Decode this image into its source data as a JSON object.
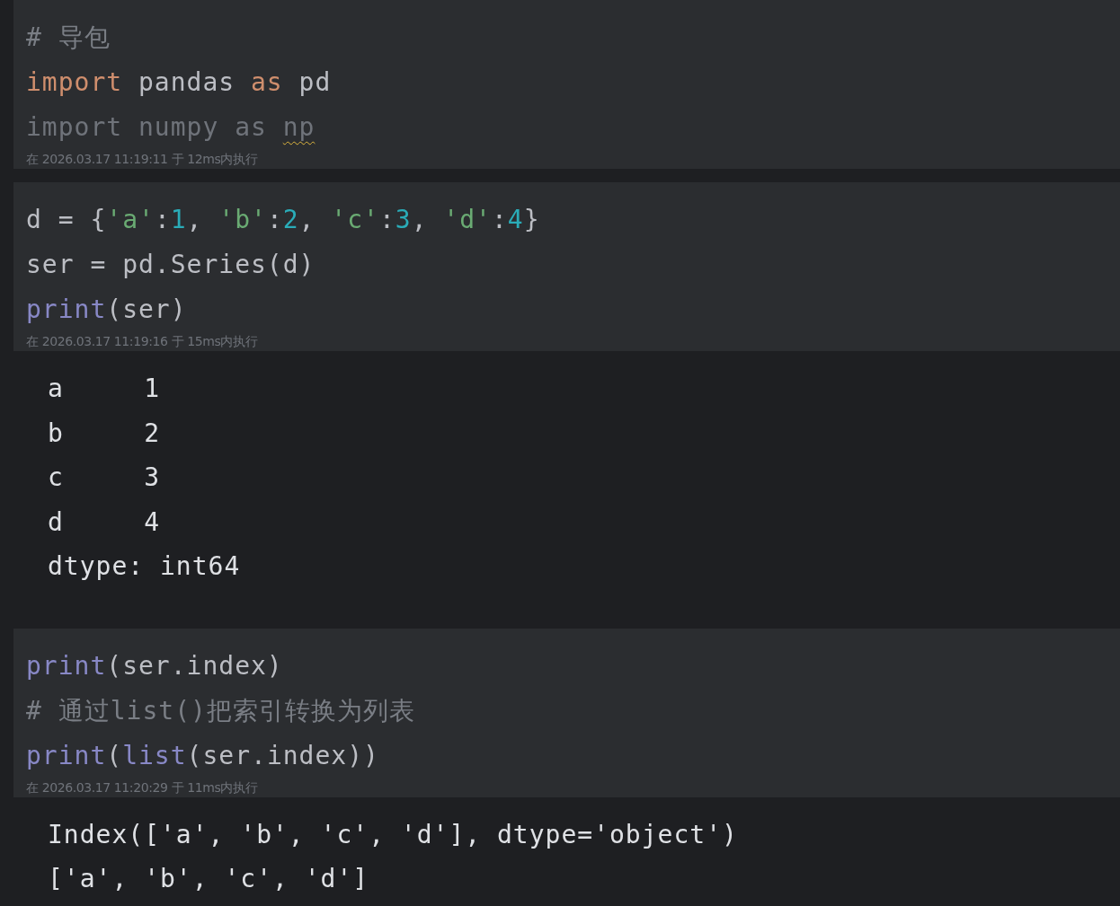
{
  "cells": [
    {
      "code": [
        [
          {
            "text": "# 导包",
            "kind": "comment"
          }
        ],
        [
          {
            "text": "import",
            "kind": "keyword"
          },
          {
            "text": " pandas ",
            "kind": "plain"
          },
          {
            "text": "as",
            "kind": "keyword"
          },
          {
            "text": " pd",
            "kind": "plain"
          }
        ],
        [
          {
            "text": "import numpy as ",
            "kind": "unused"
          },
          {
            "text": "np",
            "kind": "unused-warning"
          }
        ]
      ],
      "executed": "在 2026.03.17 11:19:11 于 12ms内执行"
    },
    {
      "code": [
        [
          {
            "text": "d = {",
            "kind": "plain"
          },
          {
            "text": "'a'",
            "kind": "string"
          },
          {
            "text": ":",
            "kind": "plain"
          },
          {
            "text": "1",
            "kind": "number"
          },
          {
            "text": ", ",
            "kind": "plain"
          },
          {
            "text": "'b'",
            "kind": "string"
          },
          {
            "text": ":",
            "kind": "plain"
          },
          {
            "text": "2",
            "kind": "number"
          },
          {
            "text": ", ",
            "kind": "plain"
          },
          {
            "text": "'c'",
            "kind": "string"
          },
          {
            "text": ":",
            "kind": "plain"
          },
          {
            "text": "3",
            "kind": "number"
          },
          {
            "text": ", ",
            "kind": "plain"
          },
          {
            "text": "'d'",
            "kind": "string"
          },
          {
            "text": ":",
            "kind": "plain"
          },
          {
            "text": "4",
            "kind": "number"
          },
          {
            "text": "}",
            "kind": "plain"
          }
        ],
        [
          {
            "text": "ser = pd.Series(d)",
            "kind": "plain"
          }
        ],
        [
          {
            "text": "print",
            "kind": "builtin"
          },
          {
            "text": "(ser)",
            "kind": "plain"
          }
        ]
      ],
      "executed": "在 2026.03.17 11:19:16 于 15ms内执行",
      "output": [
        "a     1",
        "b     2",
        "c     3",
        "d     4",
        "dtype: int64"
      ]
    },
    {
      "code": [
        [
          {
            "text": "print",
            "kind": "builtin"
          },
          {
            "text": "(ser.index)",
            "kind": "plain"
          }
        ],
        [
          {
            "text": "# 通过list()把索引转换为列表",
            "kind": "comment"
          }
        ],
        [
          {
            "text": "print",
            "kind": "builtin"
          },
          {
            "text": "(",
            "kind": "plain"
          },
          {
            "text": "list",
            "kind": "builtin"
          },
          {
            "text": "(ser.index))",
            "kind": "plain"
          }
        ]
      ],
      "executed": "在 2026.03.17 11:20:29 于 11ms内执行",
      "output": [
        "Index(['a', 'b', 'c', 'd'], dtype='object')",
        "['a', 'b', 'c', 'd']"
      ]
    }
  ]
}
